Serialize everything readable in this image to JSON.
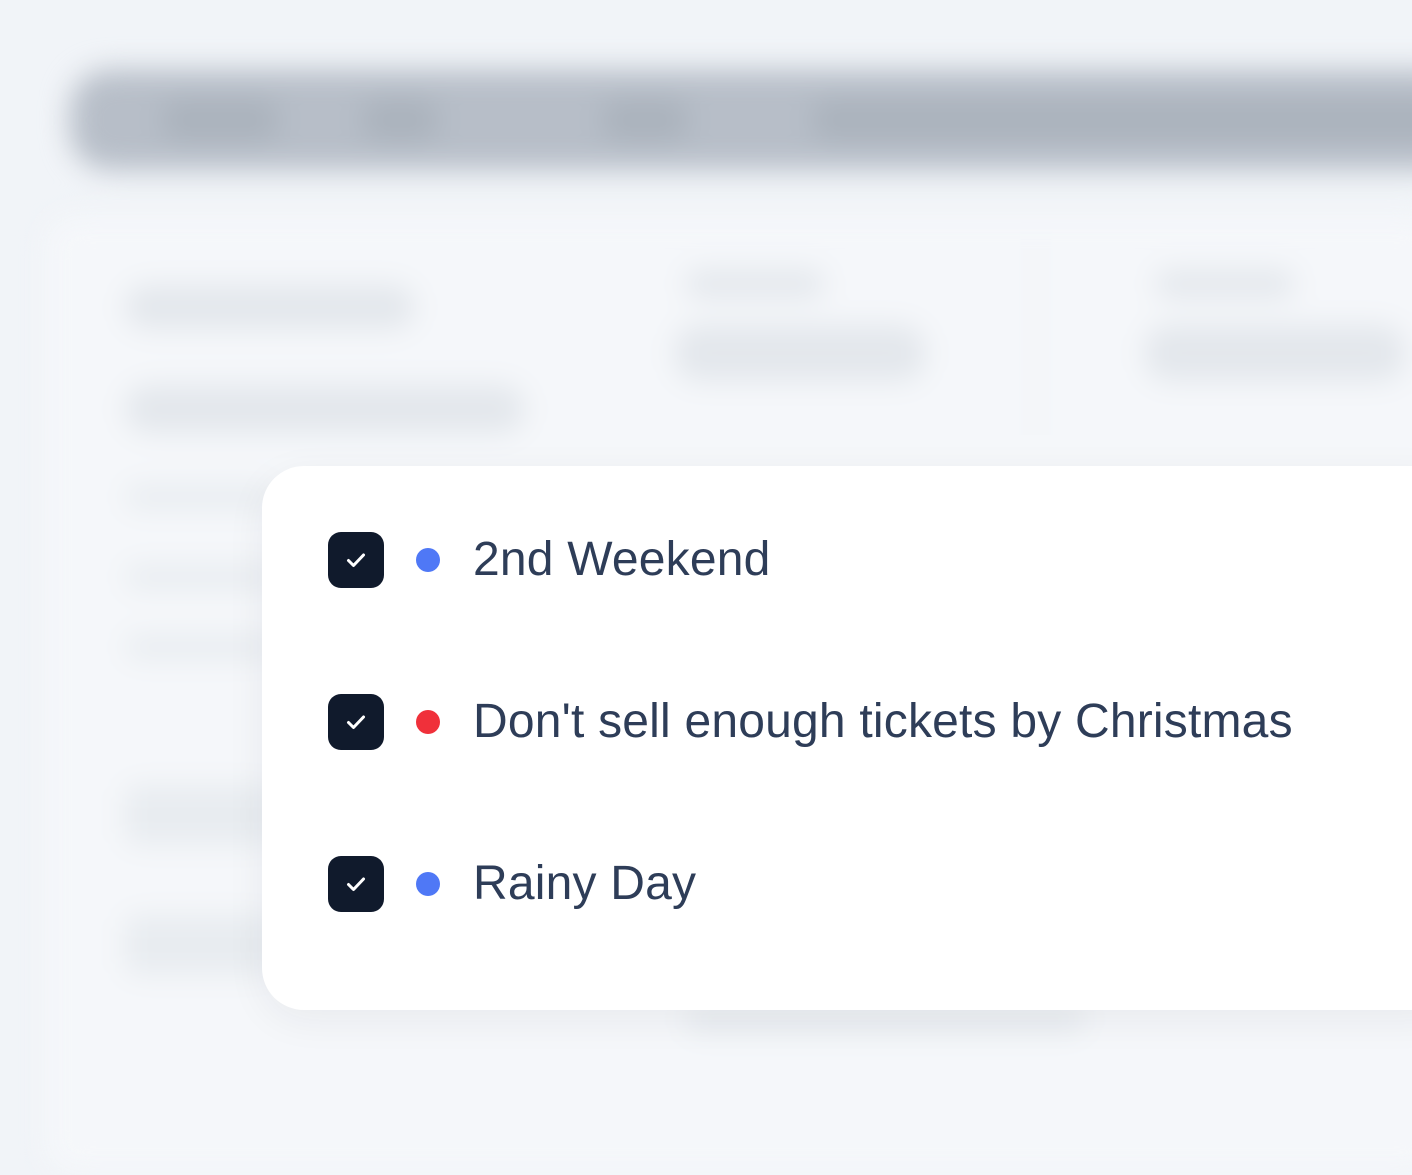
{
  "filters": {
    "items": [
      {
        "label": "2nd Weekend",
        "checked": true,
        "dot_color": "#4f78f6"
      },
      {
        "label": "Don't sell enough tickets by Christmas",
        "checked": true,
        "dot_color": "#f0303a"
      },
      {
        "label": "Rainy Day",
        "checked": true,
        "dot_color": "#4f78f6"
      }
    ],
    "checkbox_color": "#101a2c",
    "text_color": "#2e3d58"
  }
}
